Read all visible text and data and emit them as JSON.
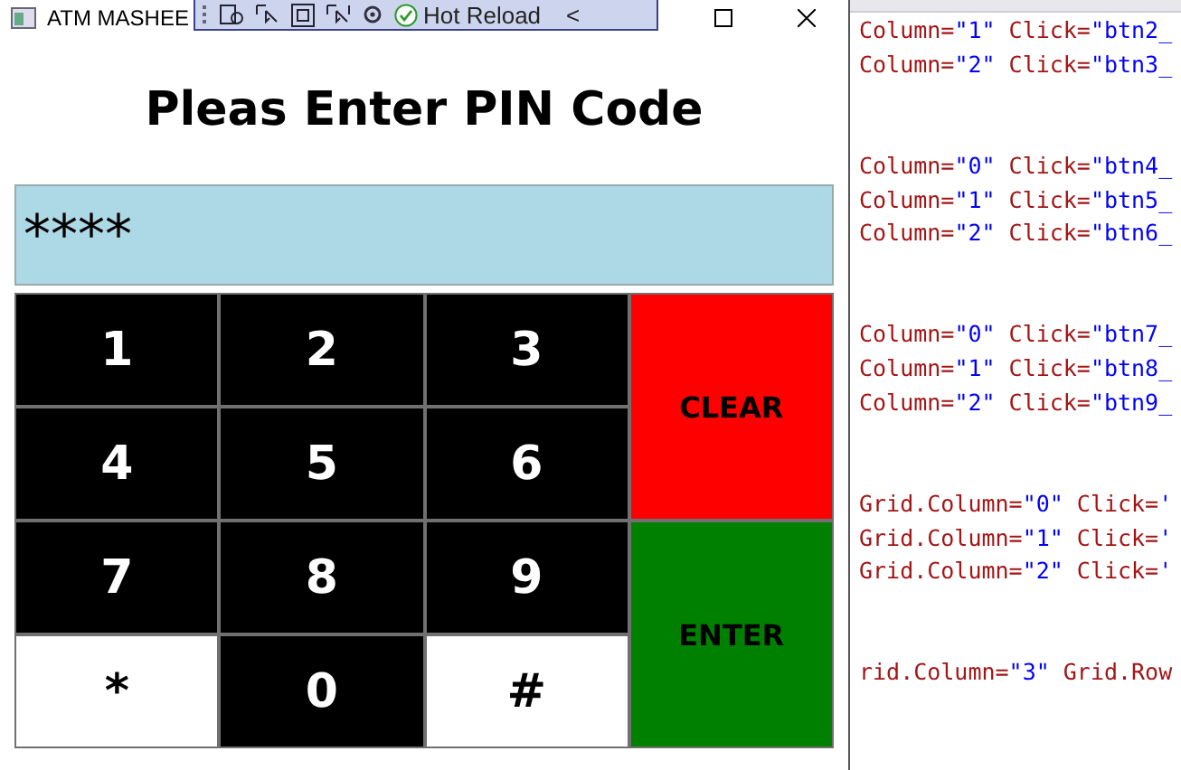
{
  "window": {
    "title": "ATM MASHEE"
  },
  "debug_toolbar": {
    "hot_reload": "Hot Reload",
    "collapse": "<"
  },
  "app": {
    "heading": "Pleas Enter PIN Code",
    "pin_display": "****",
    "keys": [
      {
        "label": "1",
        "kind": "dark",
        "color": "#000000"
      },
      {
        "label": "2",
        "kind": "dark",
        "color": "#000000"
      },
      {
        "label": "3",
        "kind": "dark",
        "color": "#000000"
      },
      {
        "label": "CLEAR",
        "kind": "action",
        "color": "#ff0000"
      },
      {
        "label": "4",
        "kind": "dark",
        "color": "#000000"
      },
      {
        "label": "5",
        "kind": "dark",
        "color": "#000000"
      },
      {
        "label": "6",
        "kind": "dark",
        "color": "#000000"
      },
      {
        "label": "7",
        "kind": "dark",
        "color": "#000000"
      },
      {
        "label": "8",
        "kind": "dark",
        "color": "#000000"
      },
      {
        "label": "9",
        "kind": "dark",
        "color": "#000000"
      },
      {
        "label": "ENTER",
        "kind": "action",
        "color": "#008000"
      },
      {
        "label": "*",
        "kind": "light",
        "color": "#ffffff"
      },
      {
        "label": "0",
        "kind": "dark",
        "color": "#000000"
      },
      {
        "label": "#",
        "kind": "light",
        "color": "#ffffff"
      }
    ]
  },
  "code_editor": {
    "blocks": [
      [
        [
          {
            "kind": "attr",
            "text": "Column="
          },
          {
            "kind": "value",
            "text": "\"1\""
          },
          {
            "kind": "attr",
            "text": " Click="
          },
          {
            "kind": "value",
            "text": "\"btn2_"
          }
        ],
        [
          {
            "kind": "attr",
            "text": "Column="
          },
          {
            "kind": "value",
            "text": "\"2\""
          },
          {
            "kind": "attr",
            "text": " Click="
          },
          {
            "kind": "value",
            "text": "\"btn3_"
          }
        ]
      ],
      [
        [
          {
            "kind": "attr",
            "text": "Column="
          },
          {
            "kind": "value",
            "text": "\"0\""
          },
          {
            "kind": "attr",
            "text": " Click="
          },
          {
            "kind": "value",
            "text": "\"btn4_"
          }
        ],
        [
          {
            "kind": "attr",
            "text": "Column="
          },
          {
            "kind": "value",
            "text": "\"1\""
          },
          {
            "kind": "attr",
            "text": " Click="
          },
          {
            "kind": "value",
            "text": "\"btn5_"
          }
        ],
        [
          {
            "kind": "attr",
            "text": "Column="
          },
          {
            "kind": "value",
            "text": "\"2\""
          },
          {
            "kind": "attr",
            "text": " Click="
          },
          {
            "kind": "value",
            "text": "\"btn6_"
          }
        ]
      ],
      [
        [
          {
            "kind": "attr",
            "text": "Column="
          },
          {
            "kind": "value",
            "text": "\"0\""
          },
          {
            "kind": "attr",
            "text": " Click="
          },
          {
            "kind": "value",
            "text": "\"btn7_"
          }
        ],
        [
          {
            "kind": "attr",
            "text": "Column="
          },
          {
            "kind": "value",
            "text": "\"1\""
          },
          {
            "kind": "attr",
            "text": " Click="
          },
          {
            "kind": "value",
            "text": "\"btn8_"
          }
        ],
        [
          {
            "kind": "attr",
            "text": "Column="
          },
          {
            "kind": "value",
            "text": "\"2\""
          },
          {
            "kind": "attr",
            "text": " Click="
          },
          {
            "kind": "value",
            "text": "\"btn9_"
          }
        ]
      ],
      [
        [
          {
            "kind": "attr",
            "text": "Grid.Column="
          },
          {
            "kind": "value",
            "text": "\"0\""
          },
          {
            "kind": "attr",
            "text": " Click="
          },
          {
            "kind": "value",
            "text": "'"
          }
        ],
        [
          {
            "kind": "attr",
            "text": "Grid.Column="
          },
          {
            "kind": "value",
            "text": "\"1\""
          },
          {
            "kind": "attr",
            "text": " Click="
          },
          {
            "kind": "value",
            "text": "'"
          }
        ],
        [
          {
            "kind": "attr",
            "text": "Grid.Column="
          },
          {
            "kind": "value",
            "text": "\"2\""
          },
          {
            "kind": "attr",
            "text": " Click="
          },
          {
            "kind": "value",
            "text": "'"
          }
        ]
      ],
      [
        [
          {
            "kind": "attr",
            "text": "rid.Column="
          },
          {
            "kind": "value",
            "text": "\"3\""
          },
          {
            "kind": "attr",
            "text": " Grid.Row"
          }
        ]
      ]
    ]
  }
}
